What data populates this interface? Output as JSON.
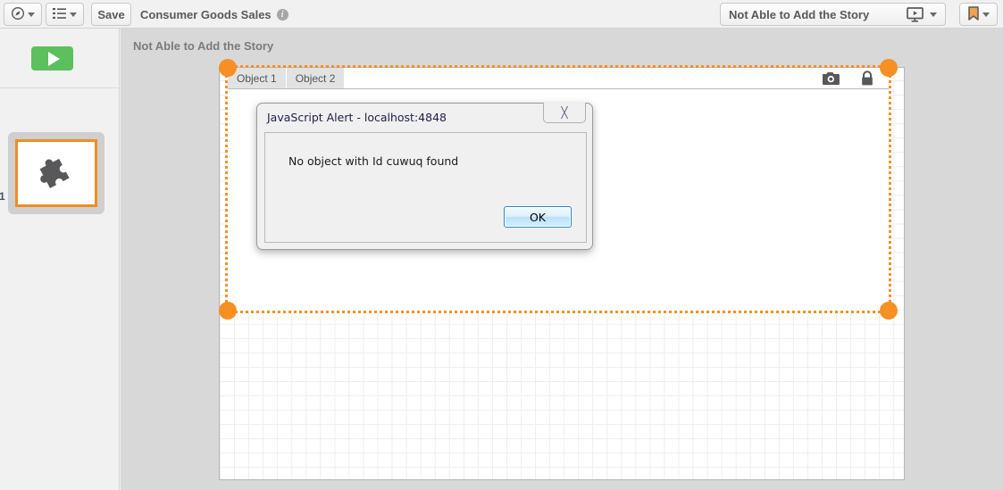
{
  "toolbar": {
    "nav_button": {
      "icon": "compass-icon",
      "caret": "chevron-down-icon"
    },
    "list_button": {
      "icon": "bullet-list-icon",
      "caret": "chevron-down-icon"
    },
    "save_label": "Save",
    "document_title": "Consumer Goods Sales",
    "info_icon": "i",
    "story_selector_label": "Not Able to Add the Story",
    "story_selector_icon": "present-monitor-icon",
    "bookmark_icon": "bookmark-icon"
  },
  "sidebar": {
    "play_button_icon": "play-triangle-icon",
    "slide_number": "1",
    "slide_thumb_icon": "puzzle-piece-icon"
  },
  "workspace": {
    "sheet_title": "Not Able to Add the Story",
    "object_tabs": [
      {
        "label": "Object 1"
      },
      {
        "label": "Object 2"
      }
    ],
    "object_icons": [
      {
        "name": "camera-icon"
      },
      {
        "name": "lock-icon"
      }
    ],
    "selection_handles": [
      "top-left",
      "top-right",
      "bottom-left",
      "bottom-right"
    ]
  },
  "alert": {
    "title": "JavaScript Alert - localhost:4848",
    "close_glyph": "╳",
    "message": "No object with Id cuwuq found",
    "ok_label": "OK"
  },
  "colors": {
    "accent_orange": "#f79024",
    "play_green": "#5cc05c",
    "toolbar_bg": "#f1f1f1",
    "workspace_bg": "#d8d8d8",
    "canvas_bg": "#ffffff"
  }
}
